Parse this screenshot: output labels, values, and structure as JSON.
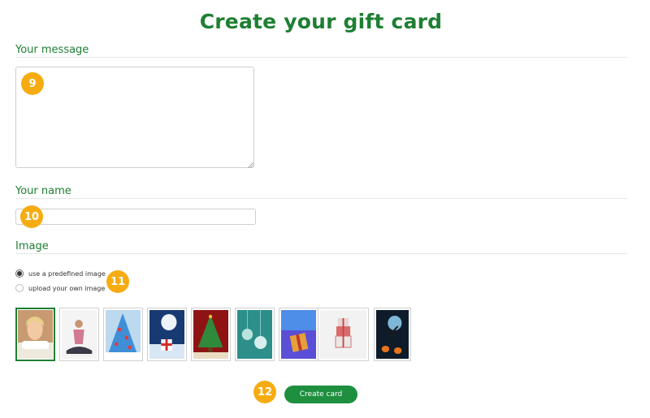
{
  "page": {
    "title": "Create your gift card",
    "accent_color": "#1e7f33",
    "badge_color": "#f6ac11"
  },
  "message": {
    "label": "Your message",
    "value": ""
  },
  "name": {
    "label": "Your name",
    "value": ""
  },
  "image": {
    "label": "Image",
    "options": [
      {
        "label": "use a predefined image",
        "checked": true
      },
      {
        "label": "upload your own image",
        "checked": false
      }
    ],
    "thumbnails": [
      {
        "name": "spa-woman-thumbnail",
        "selected": true
      },
      {
        "name": "yoga-thumbnail",
        "selected": false
      },
      {
        "name": "christmas-tree-blue-thumbnail",
        "selected": false
      },
      {
        "name": "santa-moon-gift-thumbnail",
        "selected": false
      },
      {
        "name": "christmas-tree-red-thumbnail",
        "selected": false
      },
      {
        "name": "ornaments-teal-thumbnail",
        "selected": false
      },
      {
        "name": "gift-purple-thumbnail",
        "selected": false
      },
      {
        "name": "gift-boxes-grey-thumbnail",
        "selected": false
      },
      {
        "name": "halloween-thumbnail",
        "selected": false
      }
    ]
  },
  "badges": [
    "9",
    "10",
    "11",
    "12"
  ],
  "actions": {
    "create_label": "Create card"
  }
}
